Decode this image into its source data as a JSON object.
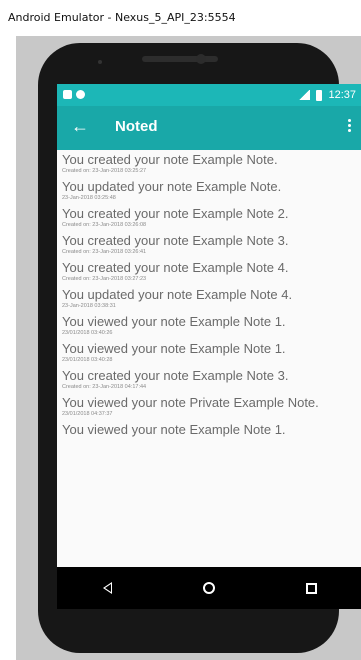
{
  "window": {
    "title": "Android Emulator - Nexus_5_API_23:5554"
  },
  "status_bar": {
    "time": "12:37"
  },
  "app_bar": {
    "title": "Noted",
    "back_icon": "arrow-left-icon",
    "menu_icon": "overflow-menu-icon"
  },
  "activity": [
    {
      "text": "You created your note Example Note.",
      "meta": "Created on: 23-Jan-2018 03:25:27"
    },
    {
      "text": "You updated your note Example Note.",
      "meta": "23-Jan-2018 03:25:48"
    },
    {
      "text": "You created your note Example Note 2.",
      "meta": "Created on: 23-Jan-2018 03:26:08"
    },
    {
      "text": "You created your note Example Note 3.",
      "meta": "Created on: 23-Jan-2018 03:26:41"
    },
    {
      "text": "You created your note Example Note 4.",
      "meta": "Created on: 23-Jan-2018 03:27:23"
    },
    {
      "text": "You updated your note Example Note 4.",
      "meta": "23-Jan-2018 03:38:31"
    },
    {
      "text": "You viewed your note Example Note 1.",
      "meta": "23/01/2018 03:40:26"
    },
    {
      "text": "You viewed your note Example Note 1.",
      "meta": "23/01/2018 03:40:28"
    },
    {
      "text": "You created your note Example Note 3.",
      "meta": "Created on: 23-Jan-2018 04:17:44"
    },
    {
      "text": "You viewed your note Private Example Note.",
      "meta": "23/01/2018 04:37:37"
    },
    {
      "text": "You viewed your note Example Note 1.",
      "meta": ""
    }
  ],
  "colors": {
    "status_bar": "#1cb7b7",
    "app_bar": "#19a8a8",
    "background": "#fafafa"
  }
}
